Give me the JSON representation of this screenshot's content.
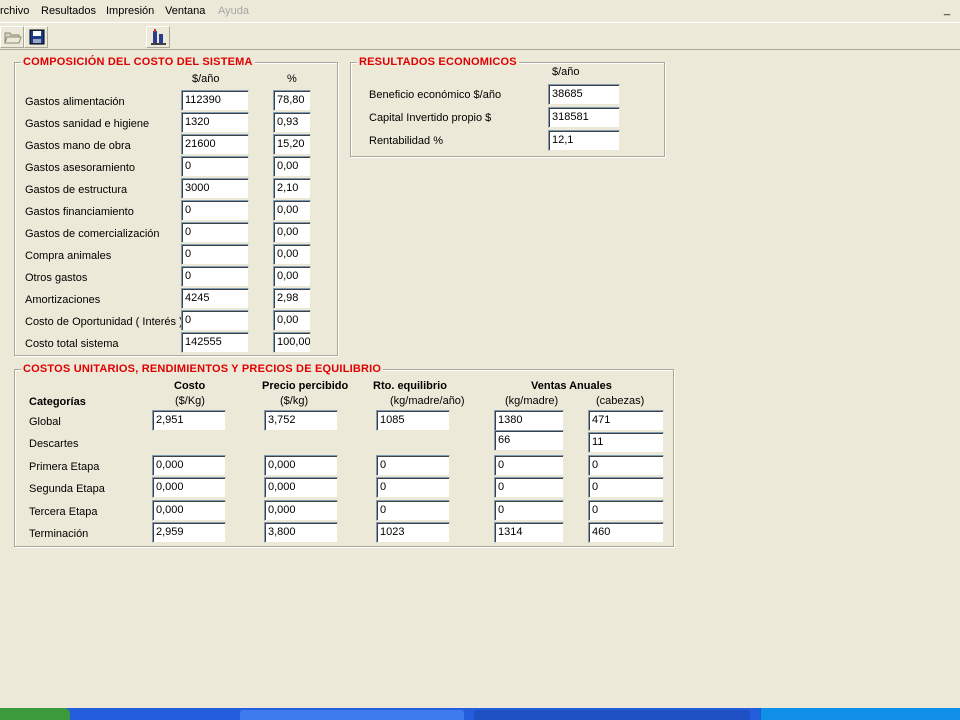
{
  "menu": {
    "archivo": "rchivo",
    "resultados": "Resultados",
    "impresion": "Impresión",
    "ventana": "Ventana",
    "ayuda": "Ayuda",
    "minimize": "_"
  },
  "toolbar": {
    "icons": [
      "open-folder-icon",
      "save-disk-icon",
      "report-icon"
    ]
  },
  "composicion": {
    "title": "COMPOSICIÓN DEL COSTO DEL SISTEMA",
    "col_value": "$/año",
    "col_pct": "%",
    "rows": [
      {
        "label": "Gastos alimentación",
        "value": "112390",
        "pct": "78,80"
      },
      {
        "label": "Gastos sanidad e higiene",
        "value": "1320",
        "pct": "0,93"
      },
      {
        "label": "Gastos mano de obra",
        "value": "21600",
        "pct": "15,20"
      },
      {
        "label": "Gastos asesoramiento",
        "value": "0",
        "pct": "0,00"
      },
      {
        "label": "Gastos de estructura",
        "value": "3000",
        "pct": "2,10"
      },
      {
        "label": "Gastos financiamiento",
        "value": "0",
        "pct": "0,00"
      },
      {
        "label": "Gastos de comercialización",
        "value": "0",
        "pct": "0,00"
      },
      {
        "label": "Compra animales",
        "value": "0",
        "pct": "0,00"
      },
      {
        "label": "Otros gastos",
        "value": "0",
        "pct": "0,00"
      },
      {
        "label": "Amortizaciones",
        "value": "4245",
        "pct": "2,98"
      },
      {
        "label": "Costo de Oportunidad ( Interés )",
        "value": "0",
        "pct": "0,00"
      },
      {
        "label": "Costo total sistema",
        "value": "142555",
        "pct": "100,00"
      }
    ]
  },
  "economicos": {
    "title": "RESULTADOS ECONOMICOS",
    "col_value": "$/año",
    "rows": [
      {
        "label": "Beneficio económico $/año",
        "value": "38685"
      },
      {
        "label": "Capital Invertido propio $",
        "value": "318581"
      },
      {
        "label": "Rentabilidad  %",
        "value": "12,1"
      }
    ]
  },
  "unitarios": {
    "title": "COSTOS UNITARIOS, RENDIMIENTOS Y PRECIOS DE EQUILIBRIO",
    "categorias_label": "Categorías",
    "headers": {
      "costo": "Costo",
      "costo_unit": "($/Kg)",
      "precio": "Precio percibido",
      "precio_unit": "($/kg)",
      "rto": "Rto. equilibrio",
      "rto_unit": "(kg/madre/año)",
      "ventas": "Ventas Anuales",
      "ventas_kg_unit": "(kg/madre)",
      "ventas_cab_unit": "(cabezas)"
    },
    "rows": [
      {
        "label": "Global",
        "costo": "2,951",
        "precio": "3,752",
        "rto": "1085",
        "ventas_kg": "1380",
        "ventas_cab": "471"
      },
      {
        "label": "Descartes",
        "costo": "",
        "precio": "",
        "rto": "",
        "ventas_kg": "66",
        "ventas_cab": "11"
      },
      {
        "label": "Primera Etapa",
        "costo": "0,000",
        "precio": "0,000",
        "rto": "0",
        "ventas_kg": "0",
        "ventas_cab": "0"
      },
      {
        "label": "Segunda Etapa",
        "costo": "0,000",
        "precio": "0,000",
        "rto": "0",
        "ventas_kg": "0",
        "ventas_cab": "0"
      },
      {
        "label": "Tercera Etapa",
        "costo": "0,000",
        "precio": "0,000",
        "rto": "0",
        "ventas_kg": "0",
        "ventas_cab": "0"
      },
      {
        "label": "Terminación",
        "costo": "2,959",
        "precio": "3,800",
        "rto": "1023",
        "ventas_kg": "1314",
        "ventas_cab": "460"
      }
    ]
  },
  "colors": {
    "background": "#ECE9D8",
    "group_title": "#E00000",
    "field_background": "#FFFFFF",
    "taskbar": "#245EDC"
  }
}
